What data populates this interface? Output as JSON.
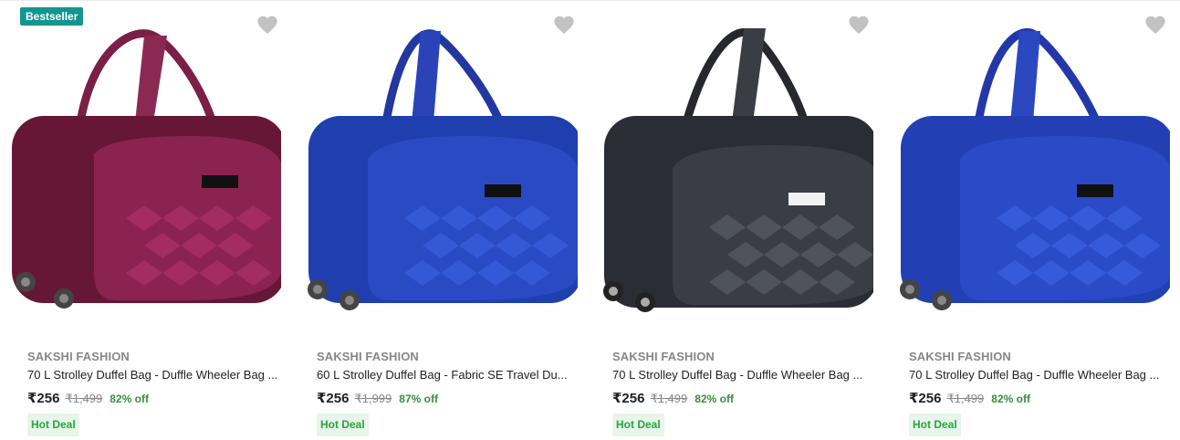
{
  "badge_label": "Bestseller",
  "products": [
    {
      "brand": "SAKSHI FASHION",
      "title": "70 L Strolley Duffel Bag - Duffle Wheeler Bag ...",
      "price": "₹256",
      "mrp": "₹1,499",
      "discount": "82% off",
      "deal": "Hot Deal",
      "color": "#6e1a3a",
      "wishlist_icon": "heart-icon"
    },
    {
      "brand": "SAKSHI FASHION",
      "title": "60 L Strolley Duffel Bag - Fabric SE Travel Du...",
      "price": "₹256",
      "mrp": "₹1,999",
      "discount": "87% off",
      "deal": "Hot Deal",
      "color": "#1f3fae",
      "wishlist_icon": "heart-icon"
    },
    {
      "brand": "SAKSHI FASHION",
      "title": "70 L Strolley Duffel Bag - Duffle Wheeler Bag ...",
      "price": "₹256",
      "mrp": "₹1,499",
      "discount": "82% off",
      "deal": "Hot Deal",
      "color": "#2a2d33",
      "wishlist_icon": "heart-icon"
    },
    {
      "brand": "SAKSHI FASHION",
      "title": "70 L Strolley Duffel Bag - Duffle Wheeler Bag ...",
      "price": "₹256",
      "mrp": "₹1,499",
      "discount": "82% off",
      "deal": "Hot Deal",
      "color": "#2240b4",
      "wishlist_icon": "heart-icon"
    }
  ]
}
